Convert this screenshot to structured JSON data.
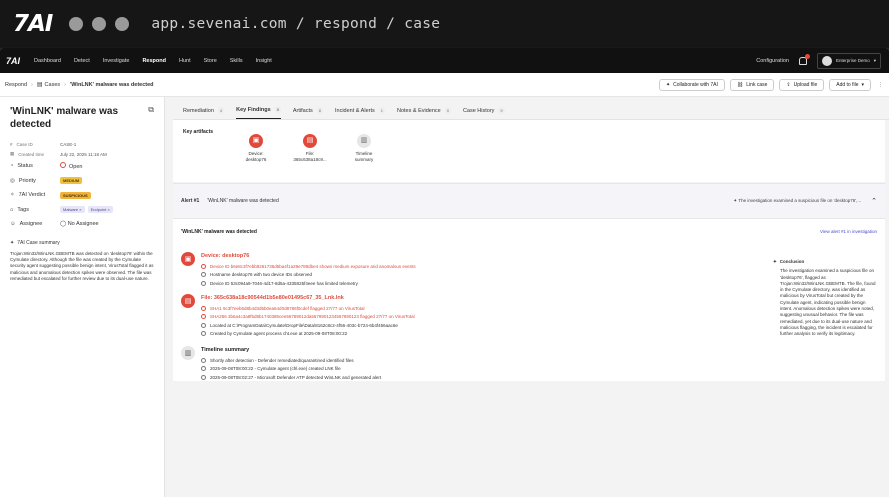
{
  "chrome": {
    "brand": "7AI",
    "url": "app.sevenai.com / respond / case"
  },
  "nav": {
    "logo": "7AI",
    "items": [
      "Dashboard",
      "Detect",
      "Investigate",
      "Respond",
      "Hunt",
      "Store",
      "Skills",
      "Insight"
    ],
    "active": "Respond",
    "configuration": "Configuration",
    "user": "Enterprise Demo",
    "notification_count": "1"
  },
  "breadcrumb": {
    "root": "Respond",
    "cases": "Cases",
    "current": "'WinLNK' malware was detected",
    "actions": [
      "Collaborate with 7AI",
      "Link case",
      "Upload file",
      "Add to file"
    ],
    "more": "⋮"
  },
  "case": {
    "title": "'WinLNK' malware was detected",
    "meta": [
      {
        "label": "Case ID",
        "value": "CASE-1"
      },
      {
        "label": "Created time",
        "value": "July 22, 2025 11:18 AM"
      }
    ],
    "status_label": "Status",
    "status_value": "Open",
    "priority_label": "Priority",
    "priority_value": "MEDIUM",
    "verdict_label": "7AI Verdict",
    "verdict_value": "SUSPICIOUS",
    "tags_label": "Tags",
    "tags": [
      "Malware",
      "Endpoint"
    ],
    "assignee_label": "Assignee",
    "assignee_value": "No Assignee",
    "summary_heading": "7AI Case summary",
    "summary": "Trojan:Win32/WinLNK.GBEMTB was detected on 'desktop76' within the Cymulate directory. Although the file was created by the Cymulate security agent suggesting possible benign intent, VirusTotal flagged it as malicious and anomalous detection spikes were observed. The file was remediated but escalated for further review due to its dual-use nature."
  },
  "tabs": [
    {
      "label": "Remediation",
      "count": "4"
    },
    {
      "label": "Key Findings",
      "count": "3"
    },
    {
      "label": "Artifacts",
      "count": "8"
    },
    {
      "label": "Incident & Alerts",
      "count": "1"
    },
    {
      "label": "Notes & Evidence",
      "count": "0"
    },
    {
      "label": "Case History",
      "count": "9"
    }
  ],
  "key_artifacts": {
    "label": "Key artifacts",
    "items": [
      {
        "line1": "Device:",
        "line2": "desktop76"
      },
      {
        "line1": "File:",
        "line2": "365c638a18c9..."
      },
      {
        "line1": "Timeline",
        "line2": "summary"
      }
    ]
  },
  "alert": {
    "number": "Alert #1",
    "name": "'WinLNK' malware was detected",
    "note": "The investigation examined a suspicious file on 'desktop76',..."
  },
  "detail": {
    "heading": "'WinLNK' malware was detected",
    "view_link": "View alert #1 in investigation",
    "device": {
      "title": "Device: desktop76",
      "lines": [
        "Device ID b6e8c3f7ebb9261736d5ba4f1a29e789dbe4 shows medium exposure and anomalous events",
        "Hostname desktop76 with two device IDs observed",
        "Device ID 53c094a9-7046-4d17-8d5a-4335825f4eee has limited telemetry"
      ]
    },
    "file": {
      "title": "File: 365c638a18c90544d1b5e80e01495c67_35_Lnk.lnk",
      "lines": [
        "SHA1 9c3f7eeb6d8b4d3d5b0ea64d0d8786f0cdef flagged 27/77 on VirusTotal",
        "SHA256 3b6a4c3a8f5d8b1740385cee56789012da5678901234567890123 flagged 27/77 on VirusTotal",
        "Located at C:\\ProgramData\\Cymulate\\DropFile\\Data\\8162c8c2-4f56-403c-b724-6b4f456aac6e",
        "Created by Cymulate agent process cht.exe at 2025-09-08T08:00:22"
      ]
    },
    "timeline": {
      "title": "Timeline summary",
      "lines": [
        "Shortly after detection - Defender remediated/quarantined identified files",
        "2025-09-08T08:00:22 - Cymulate agent (chl.exe) created LNK file",
        "2025-09-08T08:02:27 - Microsoft Defender ATP detected WinLNK and generated alert"
      ]
    },
    "conclusion": {
      "heading": "Conclusion",
      "text": "The investigation examined a suspicious file on 'desktop76', flagged as Trojan:Win32/WinLNK.GBEMTB. The file, found in the Cymulate directory, was identified as malicious by VirusTotal but created by the Cymulate agent, indicating possible benign intent. Anomalous detection spikes were noted, suggesting unusual behavior. The file was remediated, yet due to its dual-use nature and malicious flagging, the incident is escalated for further analysis to verify its legitimacy."
    }
  },
  "colors": {
    "accent": "#e14a3b",
    "link": "#4a4acb"
  }
}
